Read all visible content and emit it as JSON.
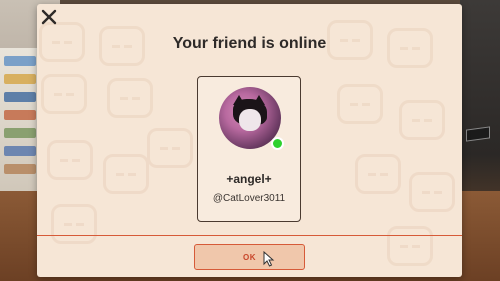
{
  "dialog": {
    "title": "Your friend is online",
    "ok_label": "OK"
  },
  "friend": {
    "display_name": "+angel+",
    "handle": "@CatLover3011",
    "status": "online",
    "avatar_icon": "cat-avatar"
  },
  "colors": {
    "online_dot": "#2ed12f",
    "accent": "#d65a38",
    "button_fill": "#f0c7ab",
    "modal_bg": "#f6e6d6"
  }
}
